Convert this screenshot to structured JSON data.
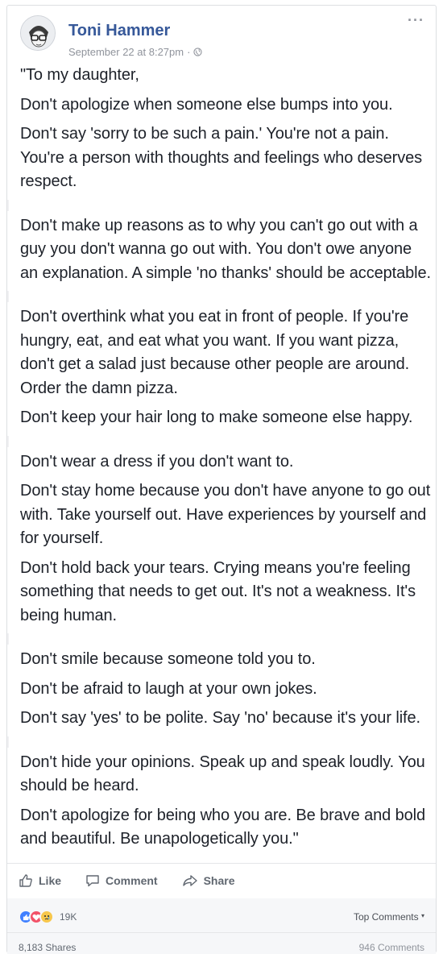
{
  "post": {
    "author": "Toni Hammer",
    "timestamp": "September 22 at 8:27pm",
    "separator": "·",
    "privacy_icon": "globe-icon",
    "more_label": "···",
    "paragraphs": [
      [
        "\"To my daughter,",
        "Don't apologize when someone else bumps into you.",
        "Don't say 'sorry to be such a pain.' You're not a pain. You're a person with thoughts and feelings who deserves respect."
      ],
      [
        "Don't make up reasons as to why you can't go out with a guy you don't wanna go out with. You don't owe anyone an explanation. A simple 'no thanks' should be acceptable."
      ],
      [
        "Don't overthink what you eat in front of people. If you're hungry, eat, and eat what you want. If you want pizza, don't get a salad just because other people are around. Order the damn pizza.",
        "Don't keep your hair long to make someone else happy."
      ],
      [
        "Don't wear a dress if you don't want to.",
        "Don't stay home because you don't have anyone to go out with. Take yourself out. Have experiences by yourself and for yourself.",
        "Don't hold back your tears. Crying means you're feeling something that needs to get out. It's not a weakness. It's being human."
      ],
      [
        "Don't smile because someone told you to.",
        "Don't be afraid to laugh at your own jokes.",
        "Don't say 'yes' to be polite. Say 'no' because it's your life."
      ],
      [
        "Don't hide your opinions. Speak up and speak loudly. You should be heard.",
        "Don't apologize for being who you are. Be brave and bold and beautiful. Be unapologetically you.\""
      ]
    ]
  },
  "actions": {
    "like": "Like",
    "comment": "Comment",
    "share": "Share"
  },
  "footer": {
    "reaction_count": "19K",
    "top_comments": "Top Comments",
    "shares": "8,183 Shares",
    "comments": "946 Comments"
  },
  "colors": {
    "author_link": "#365899",
    "muted": "#90949c",
    "like_blue": "#4080ff",
    "love_red": "#f25268",
    "sad_yellow": "#f7c74c"
  }
}
